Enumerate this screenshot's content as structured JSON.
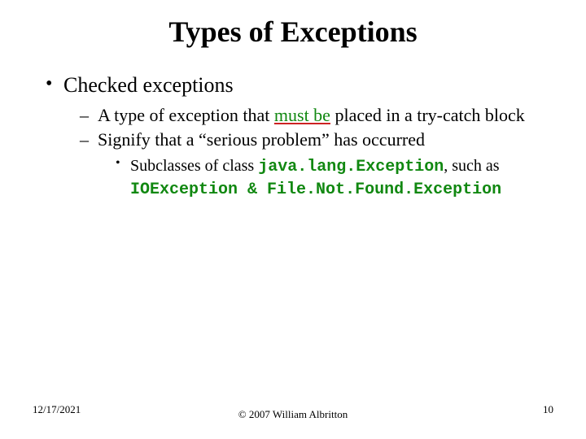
{
  "title": "Types of Exceptions",
  "bullets": {
    "lvl1_label": "Checked exceptions",
    "lvl2_a_pre": "A type of exception that ",
    "lvl2_a_emph": "must be",
    "lvl2_a_post": " placed in a try-catch block",
    "lvl2_b": "Signify that a “serious problem” has occurred",
    "lvl3_pre": "Subclasses of class ",
    "lvl3_code1": "java.lang.Exception",
    "lvl3_mid": ", such as ",
    "lvl3_code2": "IOException",
    "lvl3_amp": " & ",
    "lvl3_code3": "File.Not.Found.Exception"
  },
  "footer": {
    "date": "12/17/2021",
    "copyright": "© 2007 William Albritton",
    "page": "10"
  }
}
